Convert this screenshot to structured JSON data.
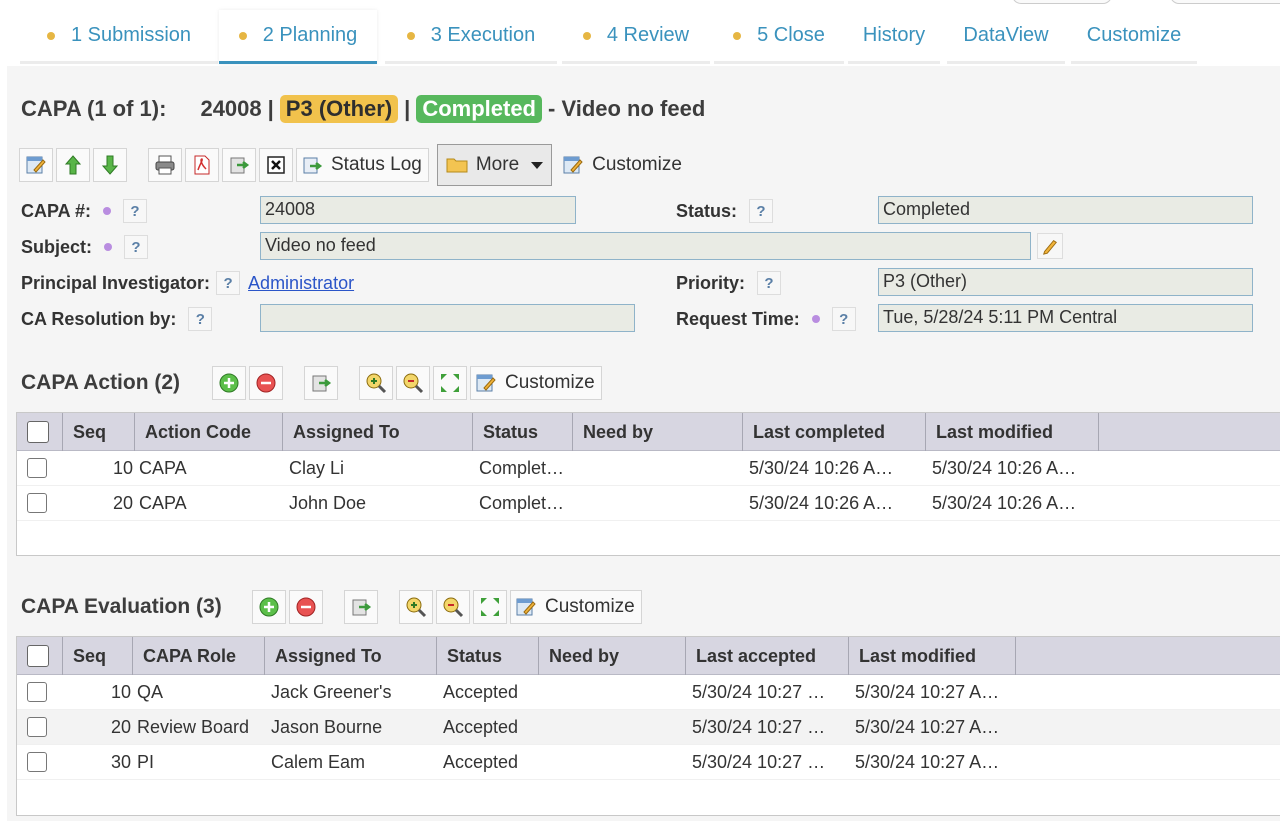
{
  "tabs": [
    {
      "label": "1 Submission",
      "dot": true
    },
    {
      "label": "2 Planning",
      "dot": true,
      "active": true
    },
    {
      "label": "3 Execution",
      "dot": true
    },
    {
      "label": "4 Review",
      "dot": true
    },
    {
      "label": "5 Close",
      "dot": true
    },
    {
      "label": "History",
      "dot": false
    },
    {
      "label": "DataView",
      "dot": false
    },
    {
      "label": "Customize",
      "dot": false
    }
  ],
  "header": {
    "record_label": "CAPA (1 of 1):",
    "record_number": "24008",
    "sep1": "|",
    "priority": "P3 (Other)",
    "sep2": "|",
    "status": "Completed",
    "subject": "- Video no feed"
  },
  "toolbar": {
    "status_log": "Status Log",
    "more": "More",
    "customize": "Customize"
  },
  "form": {
    "capa_no_label": "CAPA #:",
    "capa_no_value": "24008",
    "subject_label": "Subject:",
    "subject_value": "Video no feed",
    "pi_label": "Principal Investigator:",
    "pi_value": "Administrator",
    "ca_resolution_label": "CA Resolution by:",
    "ca_resolution_value": "",
    "status_label": "Status:",
    "status_value": "Completed",
    "priority_label": "Priority:",
    "priority_value": "P3 (Other)",
    "request_time_label": "Request Time:",
    "request_time_value": "Tue, 5/28/24 5:11 PM Central",
    "help": "?"
  },
  "capa_action": {
    "title": "CAPA Action (2)",
    "customize": "Customize",
    "columns": [
      "Seq",
      "Action Code",
      "Assigned To",
      "Status",
      "Need by",
      "Last completed",
      "Last modified"
    ],
    "rows": [
      {
        "seq": "10",
        "code": "CAPA",
        "assigned": "Clay Li",
        "status": "Complet…",
        "need": "",
        "last_completed": "5/30/24 10:26 A…",
        "last_modified": "5/30/24 10:26 A…"
      },
      {
        "seq": "20",
        "code": "CAPA",
        "assigned": "John Doe",
        "status": "Complet…",
        "need": "",
        "last_completed": "5/30/24 10:26 A…",
        "last_modified": "5/30/24 10:26 A…"
      }
    ]
  },
  "capa_evaluation": {
    "title": "CAPA Evaluation (3)",
    "customize": "Customize",
    "columns": [
      "Seq",
      "CAPA Role",
      "Assigned To",
      "Status",
      "Need by",
      "Last accepted",
      "Last modified"
    ],
    "rows": [
      {
        "seq": "10",
        "role": "QA",
        "assigned": "Jack Greener's",
        "status": "Accepted",
        "need": "",
        "last_accepted": "5/30/24 10:27 …",
        "last_modified": "5/30/24 10:27 A…"
      },
      {
        "seq": "20",
        "role": "Review Board",
        "assigned": "Jason Bourne",
        "status": "Accepted",
        "need": "",
        "last_accepted": "5/30/24 10:27 …",
        "last_modified": "5/30/24 10:27 A…"
      },
      {
        "seq": "30",
        "role": "PI",
        "assigned": "Calem Eam",
        "status": "Accepted",
        "need": "",
        "last_accepted": "5/30/24 10:27 …",
        "last_modified": "5/30/24 10:27 A…"
      }
    ]
  },
  "colors": {
    "tab_text": "#3a92bd",
    "tab_dot": "#e6b643",
    "priority_badge": "#f1c24c",
    "status_badge": "#57b85d",
    "grid_header": "#d7d6e1",
    "link": "#2b55c8"
  }
}
